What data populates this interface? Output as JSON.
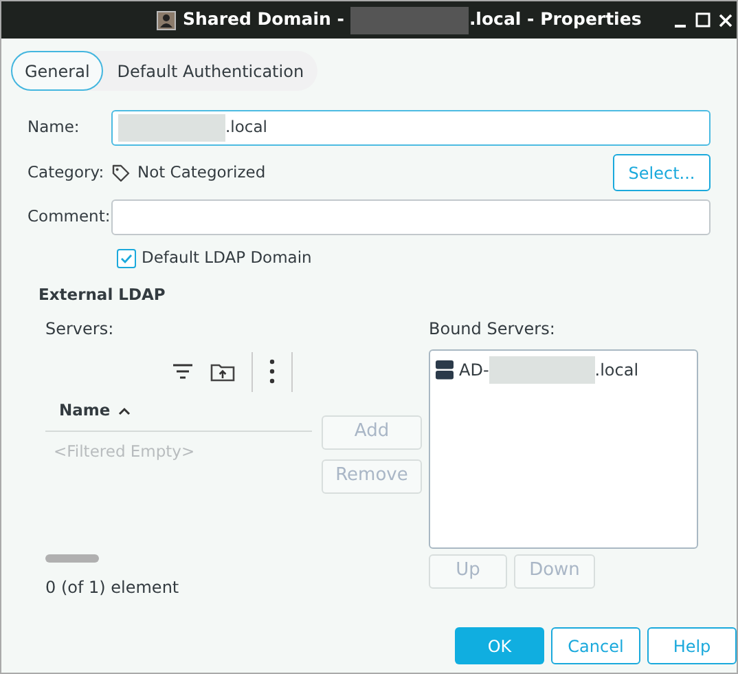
{
  "window": {
    "title_prefix": "Shared Domain -",
    "title_suffix": ".local - Properties"
  },
  "tabs": [
    {
      "label": "General",
      "selected": true
    },
    {
      "label": "Default Authentication",
      "selected": false
    }
  ],
  "form": {
    "name": {
      "label": "Name:",
      "value": ".local"
    },
    "category": {
      "label": "Category:",
      "value": "Not Categorized",
      "button": "Select..."
    },
    "comment": {
      "label": "Comment:"
    },
    "default_ldap": {
      "label": "Default LDAP Domain",
      "checked": true
    }
  },
  "external_ldap": {
    "heading": "External LDAP",
    "servers_label": "Servers:",
    "column": "Name",
    "empty_text": "<Filtered Empty>",
    "status": "0 (of 1) element",
    "add": {
      "label": "Add",
      "disabled": true
    },
    "remove": {
      "label": "Remove",
      "disabled": true
    },
    "bound_label": "Bound Servers:",
    "bound_servers": [
      {
        "prefix": "AD-",
        "suffix": ".local"
      }
    ],
    "up": {
      "label": "Up",
      "disabled": true
    },
    "down": {
      "label": "Down",
      "disabled": true
    }
  },
  "buttons": [
    {
      "label": "OK",
      "kind": "primary"
    },
    {
      "label": "Cancel",
      "kind": "secondary"
    },
    {
      "label": "Help",
      "kind": "secondary"
    }
  ]
}
